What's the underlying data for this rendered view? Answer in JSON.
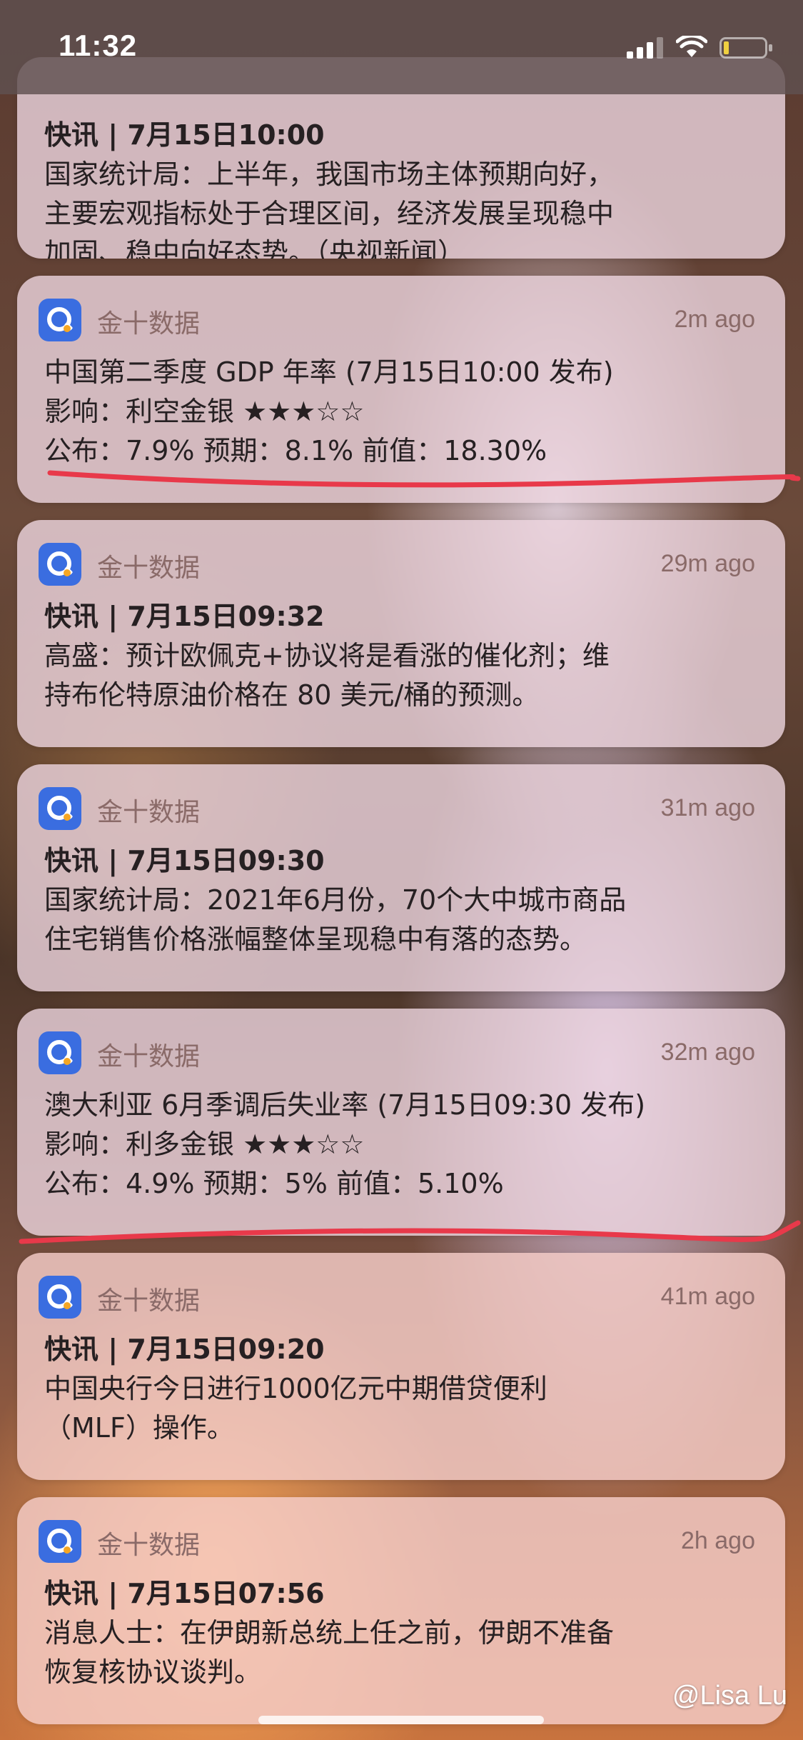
{
  "status": {
    "time": "11:32"
  },
  "notifications": [
    {
      "app": "",
      "time": "",
      "title": "快讯 | 7月15日10:00",
      "lines": [
        "国家统计局：上半年，我国市场主体预期向好，",
        "主要宏观指标处于合理区间，经济发展呈现稳中",
        "加固、稳中向好态势。（央视新闻）"
      ]
    },
    {
      "app": "金十数据",
      "time": "2m ago",
      "lines": [
        "中国第二季度 GDP 年率 (7月15日10:00 发布)",
        "影响：利空金银 ★★★☆☆",
        "公布：7.9% 预期：8.1% 前值：18.30%"
      ]
    },
    {
      "app": "金十数据",
      "time": "29m ago",
      "title": "快讯 | 7月15日09:32",
      "lines": [
        "高盛：预计欧佩克+协议将是看涨的催化剂；维",
        "持布伦特原油价格在 80 美元/桶的预测。"
      ]
    },
    {
      "app": "金十数据",
      "time": "31m ago",
      "title": "快讯 | 7月15日09:30",
      "lines": [
        "国家统计局：2021年6月份，70个大中城市商品",
        "住宅销售价格涨幅整体呈现稳中有落的态势。"
      ]
    },
    {
      "app": "金十数据",
      "time": "32m ago",
      "lines": [
        "澳大利亚 6月季调后失业率 (7月15日09:30 发布)",
        "影响：利多金银 ★★★☆☆",
        "公布：4.9% 预期：5% 前值：5.10%"
      ]
    },
    {
      "app": "金十数据",
      "time": "41m ago",
      "title": "快讯 | 7月15日09:20",
      "lines": [
        "中国央行今日进行1000亿元中期借贷便利",
        "（MLF）操作。"
      ]
    },
    {
      "app": "金十数据",
      "time": "2h ago",
      "title": "快讯 | 7月15日07:56",
      "lines": [
        "消息人士：在伊朗新总统上任之前，伊朗不准备",
        "恢复核协议谈判。"
      ]
    }
  ],
  "watermark": "@Lisa Lu",
  "colors": {
    "underline": "#e8394a",
    "app_icon": "#3a6de0"
  }
}
